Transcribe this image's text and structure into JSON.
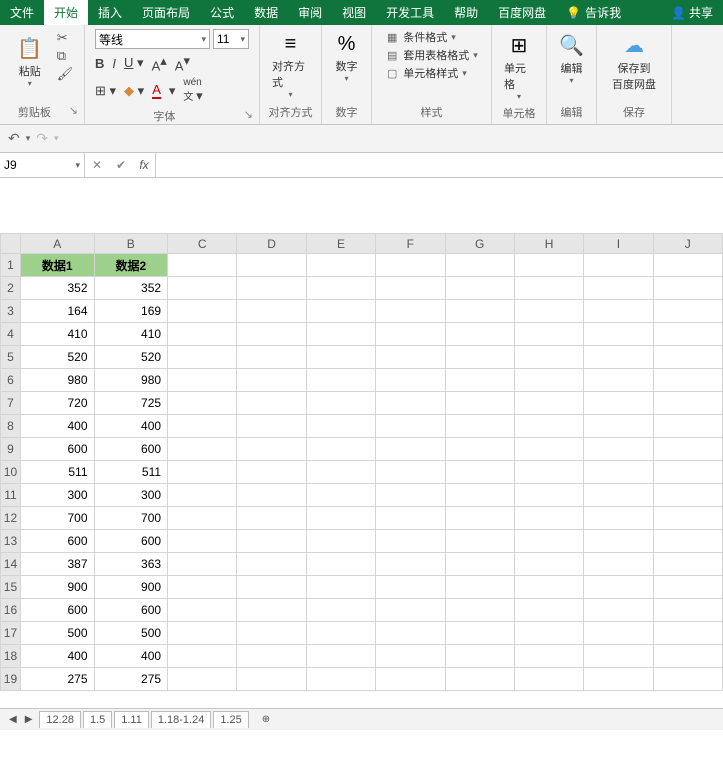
{
  "menu": {
    "file": "文件",
    "home": "开始",
    "insert": "插入",
    "layout": "页面布局",
    "formula": "公式",
    "data": "数据",
    "review": "审阅",
    "view": "视图",
    "dev": "开发工具",
    "help": "帮助",
    "baidu": "百度网盘",
    "tellme": "告诉我",
    "share": "共享"
  },
  "ribbon": {
    "clipboard": {
      "paste": "粘贴",
      "label": "剪贴板"
    },
    "font": {
      "name": "等线",
      "size": "11",
      "label": "字体"
    },
    "align": {
      "title": "对齐方式",
      "label": "对齐方式"
    },
    "number": {
      "pct": "%",
      "title": "数字",
      "label": "数字"
    },
    "styles": {
      "cond": "条件格式",
      "table": "套用表格格式",
      "cell": "单元格样式",
      "label": "样式"
    },
    "cells": {
      "title": "单元格",
      "label": "单元格"
    },
    "editing": {
      "title": "编辑",
      "label": "编辑"
    },
    "save": {
      "line1": "保存到",
      "line2": "百度网盘",
      "label": "保存"
    }
  },
  "namebox": "J9",
  "columns": [
    "A",
    "B",
    "C",
    "D",
    "E",
    "F",
    "G",
    "H",
    "I",
    "J"
  ],
  "headers": [
    "数据1",
    "数据2"
  ],
  "rows": [
    [
      352,
      352
    ],
    [
      164,
      169
    ],
    [
      410,
      410
    ],
    [
      520,
      520
    ],
    [
      980,
      980
    ],
    [
      720,
      725
    ],
    [
      400,
      400
    ],
    [
      600,
      600
    ],
    [
      511,
      511
    ],
    [
      300,
      300
    ],
    [
      700,
      700
    ],
    [
      600,
      600
    ],
    [
      387,
      363
    ],
    [
      900,
      900
    ],
    [
      600,
      600
    ],
    [
      500,
      500
    ],
    [
      400,
      400
    ],
    [
      275,
      275
    ]
  ],
  "tabs": [
    "12.28",
    "1.5",
    "1.11",
    "1.18-1.24",
    "1.25"
  ]
}
